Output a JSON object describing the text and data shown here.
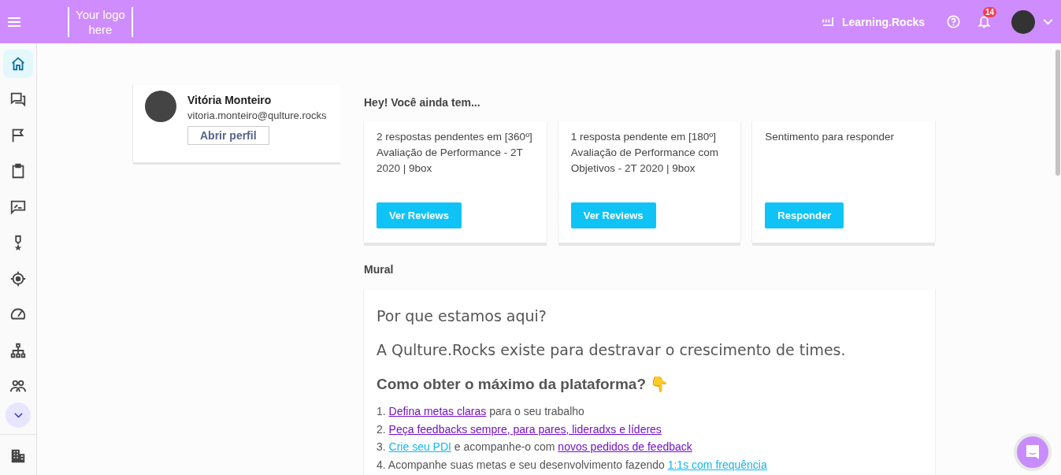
{
  "topbar": {
    "logo_line_1": "Your logo",
    "logo_line_2": "here",
    "learning_label": "Learning.Rocks",
    "notification_count": "14"
  },
  "sidebar": {
    "items": [
      {
        "kind": "home",
        "selected": true
      },
      {
        "kind": "chat",
        "selected": false
      },
      {
        "kind": "flag",
        "selected": false
      },
      {
        "kind": "clipboard",
        "selected": false
      },
      {
        "kind": "feedback",
        "selected": false
      },
      {
        "kind": "medal",
        "selected": false
      },
      {
        "kind": "target",
        "selected": false
      },
      {
        "kind": "gauge",
        "selected": false
      },
      {
        "kind": "org",
        "selected": false
      },
      {
        "kind": "people",
        "selected": false
      }
    ],
    "bottom_items": [
      {
        "kind": "building",
        "selected": false
      }
    ]
  },
  "profile": {
    "name": "Vitória Monteiro",
    "email": "vitoria.monteiro@qulture.rocks",
    "button": "Abrir perfil"
  },
  "pending": {
    "heading": "Hey! Você ainda tem...",
    "cards": [
      {
        "text": "2 respostas pendentes em [360º] Avaliação de Performance - 2T 2020 | 9box",
        "button": "Ver Reviews"
      },
      {
        "text": "1 resposta pendente em [180º] Avaliação de Performance com Objetivos - 2T 2020 | 9box",
        "button": "Ver Reviews"
      },
      {
        "text": "Sentimento para responder",
        "button": "Responder"
      }
    ]
  },
  "mural": {
    "heading": "Mural",
    "title_1": "Por que estamos aqui?",
    "title_2": "A Qulture.Rocks existe para destravar o crescimento de times.",
    "subtitle": "Como obter o máximo da plataforma? 👇",
    "list": [
      {
        "number": "1.",
        "parts": [
          {
            "kind": "link",
            "text": "Defina metas claras",
            "visited": true
          },
          {
            "kind": "text",
            "text": " para o seu trabalho"
          }
        ]
      },
      {
        "number": "2.",
        "parts": [
          {
            "kind": "link",
            "text": "Peça feedbacks sempre, para pares, lideradxs e líderes",
            "visited": true
          }
        ]
      },
      {
        "number": "3.",
        "parts": [
          {
            "kind": "link",
            "text": "Crie seu PDI",
            "visited": false
          },
          {
            "kind": "text",
            "text": " e acompanhe-o com "
          },
          {
            "kind": "link",
            "text": "novos pedidos de feedback",
            "visited": true
          }
        ]
      },
      {
        "number": "4.",
        "parts": [
          {
            "kind": "text",
            "text": "Acompanhe suas metas e seu desenvolvimento fazendo "
          },
          {
            "kind": "link",
            "text": "1:1s com frequência",
            "visited": false
          }
        ]
      }
    ]
  }
}
